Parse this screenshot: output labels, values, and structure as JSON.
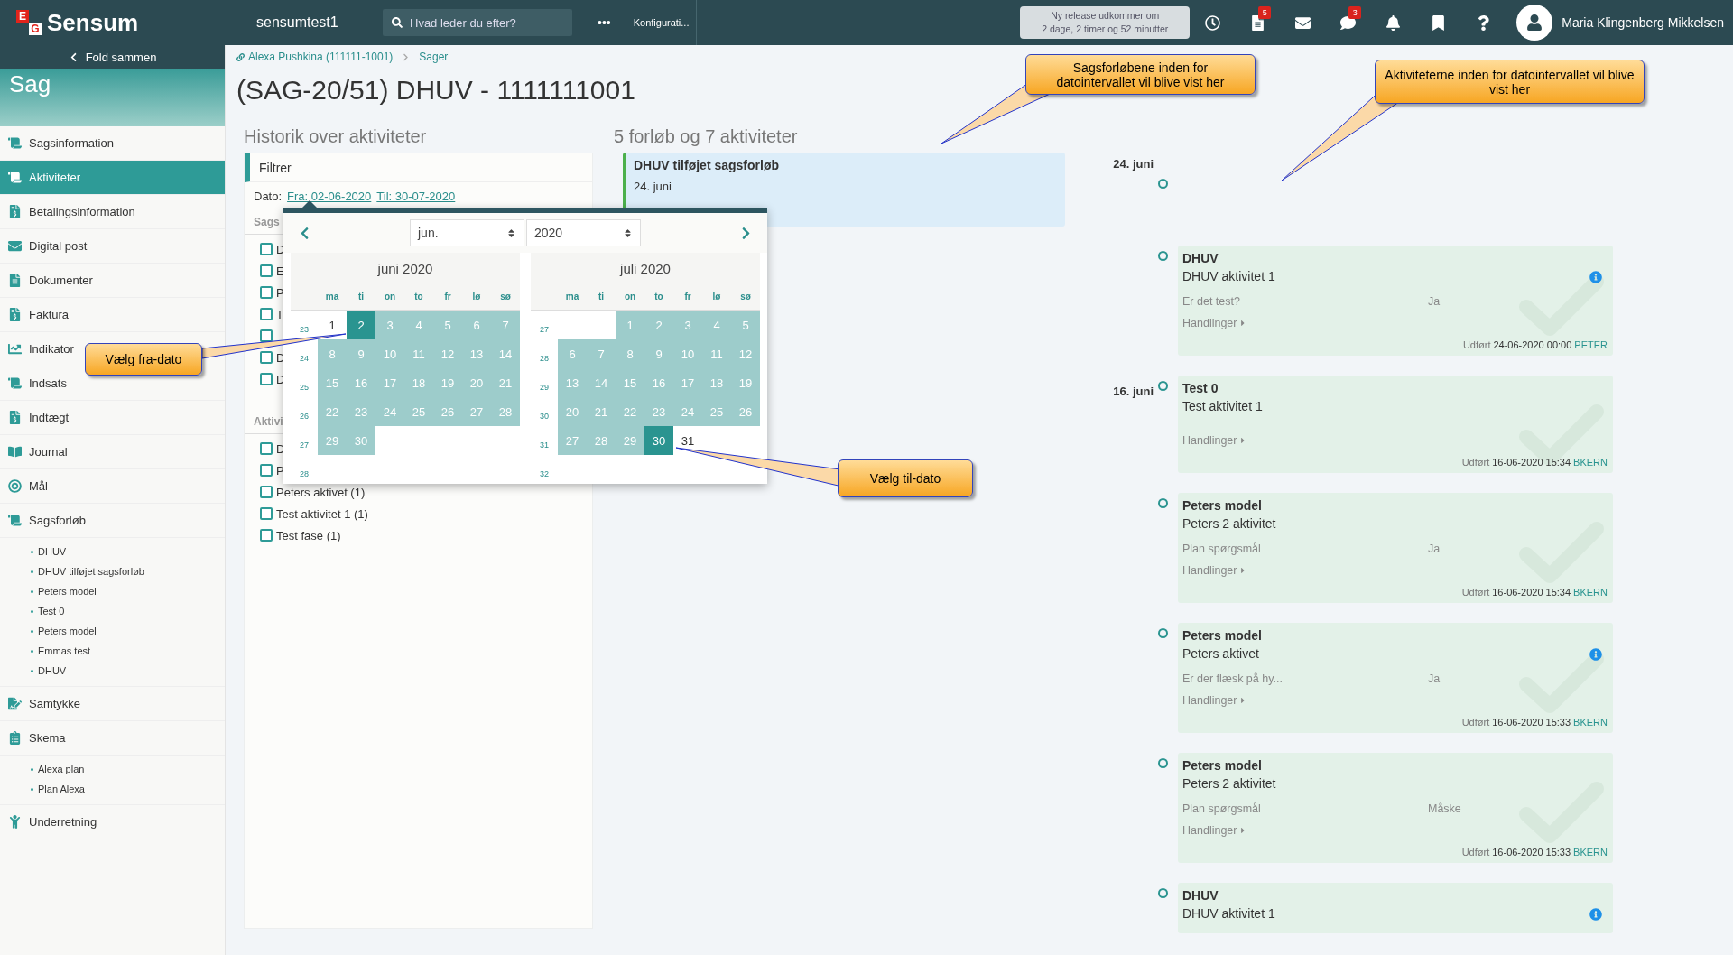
{
  "topbar": {
    "logo_letters": [
      "E",
      "G"
    ],
    "brand": "Sensum",
    "site": "sensumtest1",
    "search": {
      "placeholder": "Hvad leder du efter?"
    },
    "more": "•••",
    "config": "Konfigurati...",
    "notice_lines": [
      "Ny release udkommer om",
      "2 dage, 2 timer og 52 minutter"
    ],
    "icons": [
      {
        "kind": "clock"
      },
      {
        "kind": "document",
        "badge": "5"
      },
      {
        "kind": "mail"
      },
      {
        "kind": "chat",
        "badge": "3"
      },
      {
        "kind": "bell"
      },
      {
        "kind": "bookmark"
      },
      {
        "kind": "help"
      }
    ],
    "user": "Maria Klingenberg Mikkelsen"
  },
  "sidebar": {
    "collapse_label": "Fold sammen",
    "section_title": "Sag",
    "items": [
      {
        "label": "Sagsinformation",
        "selected": false
      },
      {
        "label": "Aktiviteter",
        "selected": true
      },
      {
        "label": "Betalingsinformation",
        "selected": false
      },
      {
        "label": "Digital post",
        "selected": false
      },
      {
        "label": "Dokumenter",
        "selected": false
      },
      {
        "label": "Faktura",
        "selected": false
      },
      {
        "label": "Indikator",
        "selected": false
      },
      {
        "label": "Indsats",
        "selected": false
      },
      {
        "label": "Indtægt",
        "selected": false
      },
      {
        "label": "Journal",
        "selected": false
      },
      {
        "label": "Mål",
        "selected": false
      },
      {
        "label": "Sagsforløb",
        "selected": false,
        "children": [
          {
            "label": "DHUV"
          },
          {
            "label": "DHUV tilføjet sagsforløb"
          },
          {
            "label": "Peters model"
          },
          {
            "label": "Test 0"
          },
          {
            "label": "Peters model"
          },
          {
            "label": "Emmas test"
          },
          {
            "label": "DHUV"
          }
        ]
      },
      {
        "label": "Samtykke",
        "selected": false
      },
      {
        "label": "Skema",
        "selected": false,
        "children": [
          {
            "label": "Alexa plan"
          },
          {
            "label": "Plan Alexa"
          }
        ]
      },
      {
        "label": "Underretning",
        "selected": false
      }
    ]
  },
  "breadcrumb": [
    "Alexa Pushkina (111111-1001)",
    "Sager"
  ],
  "title": "(SAG-20/51) DHUV - 1111111001",
  "history": {
    "heading": "Historik over aktiviteter",
    "filter_title": "Filtrer",
    "date_label": "Dato:",
    "from_link": "Fra: 02-06-2020",
    "to_link": "Til: 30-07-2020",
    "groups": [
      {
        "heading": "Sags",
        "items": [
          {
            "label": "D",
            "checked": false
          },
          {
            "label": "E",
            "checked": false
          },
          {
            "label": "P",
            "checked": false
          },
          {
            "label": "T",
            "checked": false
          },
          {
            "checked": false
          },
          {
            "label": "D",
            "checked": false
          },
          {
            "label": "D",
            "checked": false
          }
        ]
      },
      {
        "heading": "Aktivi",
        "items": [
          {
            "label": "D",
            "checked": false
          },
          {
            "label": "P",
            "checked": false
          },
          {
            "label": "Peters aktivet (1)",
            "checked": false
          },
          {
            "label": "Test aktivitet 1 (1)",
            "checked": false
          },
          {
            "label": "Test fase (1)",
            "checked": false
          }
        ]
      }
    ]
  },
  "calendar": {
    "month_select": "jun.",
    "year_select": "2020",
    "months": [
      {
        "title": "juni 2020",
        "weekdays": [
          "ma",
          "ti",
          "on",
          "to",
          "fr",
          "lø",
          "sø"
        ],
        "weeks": [
          {
            "week": "23",
            "days": [
              {
                "day": "1",
                "selected": false,
                "in_range": false
              },
              {
                "day": "2",
                "selected": true,
                "in_range": true
              },
              {
                "day": "3",
                "selected": false,
                "in_range": true
              },
              {
                "day": "4",
                "selected": false,
                "in_range": true
              },
              {
                "day": "5",
                "selected": false,
                "in_range": true
              },
              {
                "day": "6",
                "selected": false,
                "in_range": true
              },
              {
                "day": "7",
                "selected": false,
                "in_range": true
              }
            ]
          },
          {
            "week": "24",
            "days": [
              {
                "day": "8",
                "selected": false,
                "in_range": true
              },
              {
                "day": "9",
                "selected": false,
                "in_range": true
              },
              {
                "day": "10",
                "selected": false,
                "in_range": true
              },
              {
                "day": "11",
                "selected": false,
                "in_range": true
              },
              {
                "day": "12",
                "selected": false,
                "in_range": true
              },
              {
                "day": "13",
                "selected": false,
                "in_range": true
              },
              {
                "day": "14",
                "selected": false,
                "in_range": true
              }
            ]
          },
          {
            "week": "25",
            "days": [
              {
                "day": "15",
                "selected": false,
                "in_range": true
              },
              {
                "day": "16",
                "selected": false,
                "in_range": true
              },
              {
                "day": "17",
                "selected": false,
                "in_range": true
              },
              {
                "day": "18",
                "selected": false,
                "in_range": true
              },
              {
                "day": "19",
                "selected": false,
                "in_range": true
              },
              {
                "day": "20",
                "selected": false,
                "in_range": true
              },
              {
                "day": "21",
                "selected": false,
                "in_range": true
              }
            ]
          },
          {
            "week": "26",
            "days": [
              {
                "day": "22",
                "selected": false,
                "in_range": true
              },
              {
                "day": "23",
                "selected": false,
                "in_range": true
              },
              {
                "day": "24",
                "selected": false,
                "in_range": true
              },
              {
                "day": "25",
                "selected": false,
                "in_range": true
              },
              {
                "day": "26",
                "selected": false,
                "in_range": true
              },
              {
                "day": "27",
                "selected": false,
                "in_range": true
              },
              {
                "day": "28",
                "selected": false,
                "in_range": true
              }
            ]
          },
          {
            "week": "27",
            "days": [
              {
                "day": "29",
                "selected": false,
                "in_range": true
              },
              {
                "day": "30",
                "selected": false,
                "in_range": true
              }
            ]
          },
          {
            "week": "28"
          }
        ]
      },
      {
        "title": "juli 2020",
        "weekdays": [
          "ma",
          "ti",
          "on",
          "to",
          "fr",
          "lø",
          "sø"
        ],
        "weeks": [
          {
            "week": "27",
            "days": [
              {
                "kind": "blank"
              },
              {
                "kind": "blank"
              },
              {
                "day": "1",
                "selected": false,
                "in_range": true
              },
              {
                "day": "2",
                "selected": false,
                "in_range": true
              },
              {
                "day": "3",
                "selected": false,
                "in_range": true
              },
              {
                "day": "4",
                "selected": false,
                "in_range": true
              },
              {
                "day": "5",
                "selected": false,
                "in_range": true
              }
            ]
          },
          {
            "week": "28",
            "days": [
              {
                "day": "6",
                "selected": false,
                "in_range": true
              },
              {
                "day": "7",
                "selected": false,
                "in_range": true
              },
              {
                "day": "8",
                "selected": false,
                "in_range": true
              },
              {
                "day": "9",
                "selected": false,
                "in_range": true
              },
              {
                "day": "10",
                "selected": false,
                "in_range": true
              },
              {
                "day": "11",
                "selected": false,
                "in_range": true
              },
              {
                "day": "12",
                "selected": false,
                "in_range": true
              }
            ]
          },
          {
            "week": "29",
            "days": [
              {
                "day": "13",
                "selected": false,
                "in_range": true
              },
              {
                "day": "14",
                "selected": false,
                "in_range": true
              },
              {
                "day": "15",
                "selected": false,
                "in_range": true
              },
              {
                "day": "16",
                "selected": false,
                "in_range": true
              },
              {
                "day": "17",
                "selected": false,
                "in_range": true
              },
              {
                "day": "18",
                "selected": false,
                "in_range": true
              },
              {
                "day": "19",
                "selected": false,
                "in_range": true
              }
            ]
          },
          {
            "week": "30",
            "days": [
              {
                "day": "20",
                "selected": false,
                "in_range": true
              },
              {
                "day": "21",
                "selected": false,
                "in_range": true
              },
              {
                "day": "22",
                "selected": false,
                "in_range": true
              },
              {
                "day": "23",
                "selected": false,
                "in_range": true
              },
              {
                "day": "24",
                "selected": false,
                "in_range": true
              },
              {
                "day": "25",
                "selected": false,
                "in_range": true
              },
              {
                "day": "26",
                "selected": false,
                "in_range": true
              }
            ]
          },
          {
            "week": "31",
            "days": [
              {
                "day": "27",
                "selected": false,
                "in_range": true
              },
              {
                "day": "28",
                "selected": false,
                "in_range": true
              },
              {
                "day": "29",
                "selected": false,
                "in_range": true
              },
              {
                "day": "30",
                "selected": true,
                "in_range": true
              },
              {
                "day": "31",
                "selected": false,
                "in_range": false
              }
            ]
          },
          {
            "week": "32"
          }
        ]
      }
    ]
  },
  "courses": {
    "heading": "5 forløb og 7 aktiviteter",
    "items": [
      {
        "title": "DHUV tilføjet sagsforløb",
        "date": "24. juni"
      }
    ]
  },
  "timeline": [
    {
      "kind": "course",
      "date": "24. juni"
    },
    {
      "kind": "activity",
      "title": "DHUV",
      "subtitle": "DHUV aktivitet 1",
      "info": true,
      "question": "Er det test?",
      "answer": "Ja",
      "actions": "Handlinger",
      "done_label": "Udført",
      "timestamp": "24-06-2020 00:00",
      "user": "PETER"
    },
    {
      "kind": "activity",
      "date": "16. juni",
      "title": "Test 0",
      "subtitle": "Test aktivitet 1",
      "info": false,
      "actions": "Handlinger",
      "done_label": "Udført",
      "timestamp": "16-06-2020 15:34",
      "user": "BKERN"
    },
    {
      "kind": "activity",
      "title": "Peters model",
      "subtitle": "Peters 2 aktivitet",
      "info": false,
      "question": "Plan spørgsmål",
      "answer": "Ja",
      "actions": "Handlinger",
      "done_label": "Udført",
      "timestamp": "16-06-2020 15:34",
      "user": "BKERN"
    },
    {
      "kind": "activity",
      "title": "Peters model",
      "subtitle": "Peters aktivet",
      "info": true,
      "question": "Er der flæsk på hy...",
      "answer": "Ja",
      "actions": "Handlinger",
      "done_label": "Udført",
      "timestamp": "16-06-2020 15:33",
      "user": "BKERN"
    },
    {
      "kind": "activity",
      "title": "Peters model",
      "subtitle": "Peters 2 aktivitet",
      "info": false,
      "question": "Plan spørgsmål",
      "answer": "Måske",
      "actions": "Handlinger",
      "done_label": "Udført",
      "timestamp": "16-06-2020 15:33",
      "user": "BKERN"
    },
    {
      "kind": "activity",
      "title": "DHUV",
      "subtitle": "DHUV aktivitet 1",
      "info": true
    }
  ],
  "annotations": [
    {
      "text": "Sagsforløbene inden for datointervallet vil blive vist her"
    },
    {
      "text": "Aktiviteterne inden for datointervallet vil blive vist her"
    },
    {
      "text": "Vælg fra-dato"
    },
    {
      "text": "Vælg til-dato"
    }
  ]
}
